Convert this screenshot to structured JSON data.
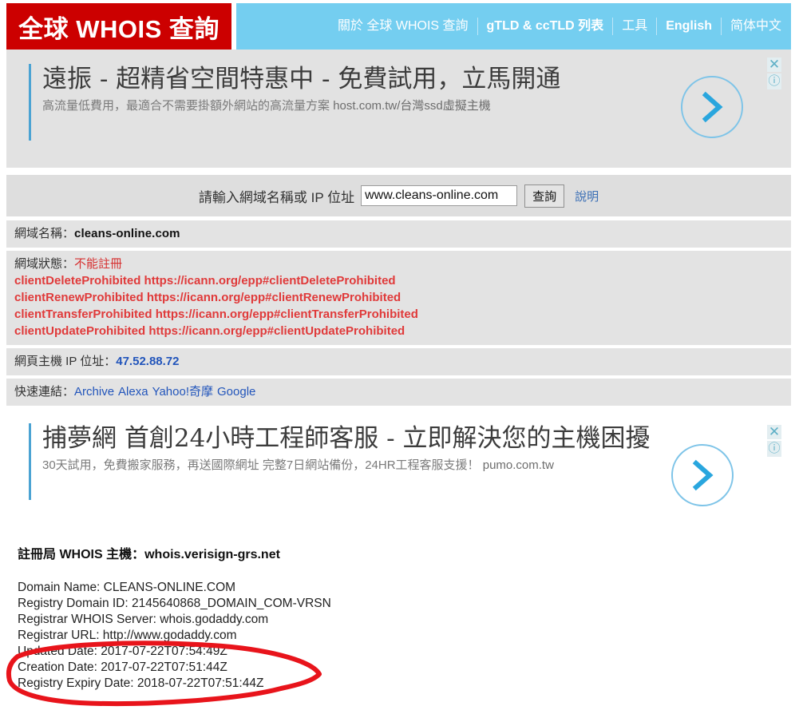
{
  "site": {
    "logo_text": "全球 WHOIS 查詢",
    "logo_bg": "#CC0000",
    "nav_bg": "#74CEF0"
  },
  "nav": {
    "items": [
      {
        "label": "關於 全球 WHOIS 查詢",
        "bold": false
      },
      {
        "label": "gTLD & ccTLD 列表",
        "bold": true
      },
      {
        "label": "工具",
        "bold": false
      },
      {
        "label": "English",
        "bold": true
      },
      {
        "label": "简体中文",
        "bold": false
      }
    ]
  },
  "ads": {
    "top": {
      "headline": "遠振 - 超精省空間特惠中 - 免費試用，立馬開通",
      "subtext": "高流量低費用，最適合不需要掛額外網站的高流量方案",
      "url": "host.com.tw/台灣ssd虛擬主機",
      "close_icon": "✕",
      "info_icon": "ⓘ",
      "arrow_icon": "chevron-right-icon"
    },
    "bottom": {
      "headline": "捕夢網 首創24小時工程師客服 - 立即解決您的主機困擾",
      "subtext": "30天試用，免費搬家服務，再送國際網址 完整7日網站備份，24HR工程客服支援！",
      "url": "pumo.com.tw",
      "close_icon": "✕",
      "info_icon": "ⓘ",
      "arrow_icon": "chevron-right-icon"
    }
  },
  "search": {
    "label": "請輸入網域名稱或 IP 位址",
    "value": "www.cleans-online.com",
    "placeholder": "www.cleans-online.com",
    "button_label": "查詢",
    "help_label": "說明"
  },
  "results": {
    "domain_label": "網域名稱：",
    "domain_value": "cleans-online.com",
    "status_label": "網域狀態：",
    "status_value": "不能註冊",
    "status_lines": [
      "clientDeleteProhibited https://icann.org/epp#clientDeleteProhibited",
      "clientRenewProhibited https://icann.org/epp#clientRenewProhibited",
      "clientTransferProhibited https://icann.org/epp#clientTransferProhibited",
      "clientUpdateProhibited https://icann.org/epp#clientUpdateProhibited"
    ],
    "ip_label": "網頁主機 IP 位址：",
    "ip_value": "47.52.88.72",
    "quicklinks_label": "快速連結：",
    "quicklinks": [
      "Archive",
      "Alexa",
      "Yahoo!奇摩",
      "Google"
    ]
  },
  "whois": {
    "heading": "註冊局 WHOIS 主機：whois.verisign-grs.net",
    "raw": "Domain Name: CLEANS-ONLINE.COM\nRegistry Domain ID: 2145640868_DOMAIN_COM-VRSN\nRegistrar WHOIS Server: whois.godaddy.com\nRegistrar URL: http://www.godaddy.com\nUpdated Date: 2017-07-22T07:54:49Z\nCreation Date: 2017-07-22T07:51:44Z\nRegistry Expiry Date: 2018-07-22T07:51:44Z"
  },
  "annotation": {
    "type": "hand-drawn-red-ellipse",
    "color": "#E8141B",
    "encircles": "Updated Date and Creation Date lines"
  }
}
